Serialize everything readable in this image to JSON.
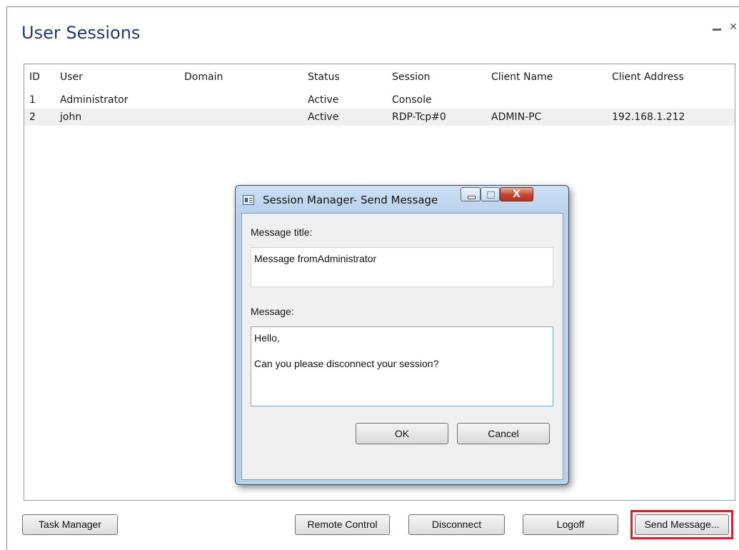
{
  "window": {
    "title": "User Sessions"
  },
  "table": {
    "headers": {
      "id": "ID",
      "user": "User",
      "domain": "Domain",
      "status": "Status",
      "session": "Session",
      "client_name": "Client Name",
      "client_address": "Client Address"
    },
    "rows": [
      {
        "id": "1",
        "user": "Administrator",
        "domain": "",
        "status": "Active",
        "session": "Console",
        "client_name": "",
        "client_address": ""
      },
      {
        "id": "2",
        "user": "john",
        "domain": "",
        "status": "Active",
        "session": "RDP-Tcp#0",
        "client_name": "ADMIN-PC",
        "client_address": "192.168.1.212"
      }
    ]
  },
  "buttons": {
    "task_manager": "Task Manager",
    "remote_control": "Remote Control",
    "disconnect": "Disconnect",
    "logoff": "Logoff",
    "send_message": "Send Message..."
  },
  "dialog": {
    "title": "Session Manager- Send Message",
    "close_glyph": "X",
    "message_title_label": "Message title:",
    "message_title_value": "Message fromAdministrator",
    "message_label": "Message:",
    "message_value": "Hello,\n\nCan you please disconnect your session?",
    "ok": "OK",
    "cancel": "Cancel"
  },
  "colors": {
    "title": "#1e3a6e",
    "highlight": "#e11d2b",
    "row_alt": "#f0f0f0"
  }
}
